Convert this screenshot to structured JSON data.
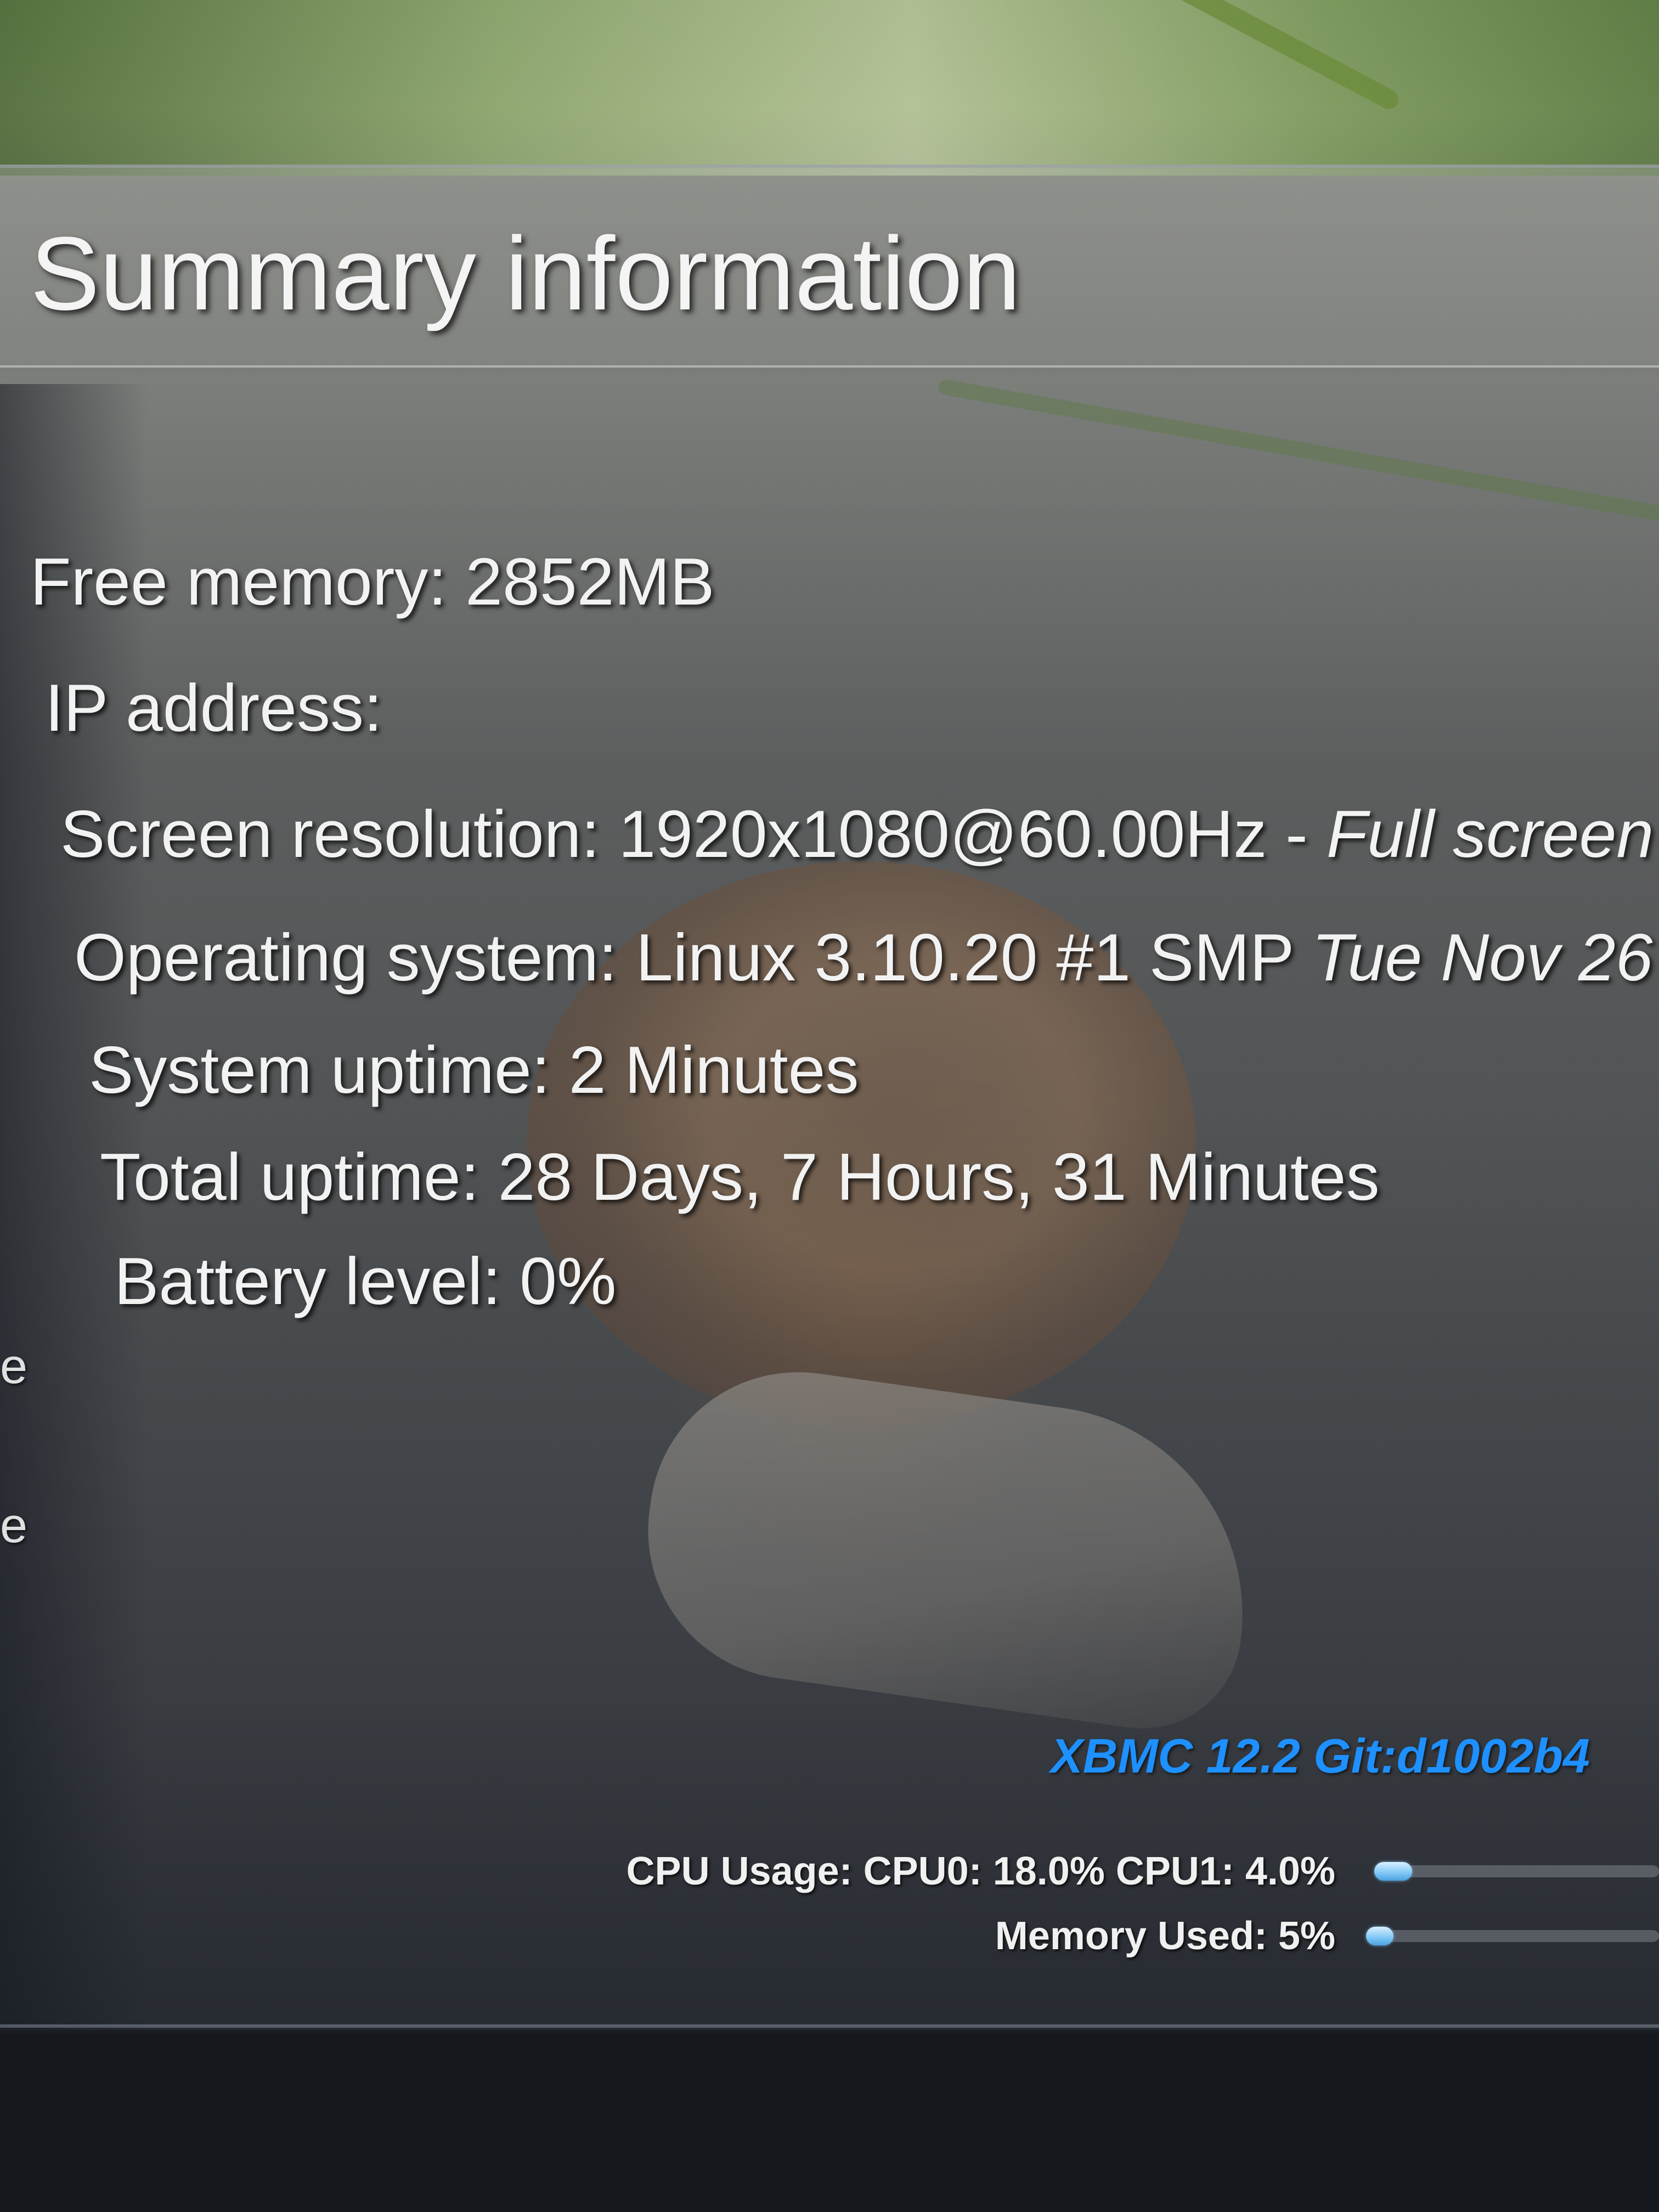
{
  "header": {
    "title": "Summary information"
  },
  "info": {
    "free_memory": "Free memory: 2852MB",
    "ip_address": "IP address:",
    "screen_resolution_label": "Screen resolution: 1920x1080@60.00Hz - ",
    "screen_resolution_mode": "Full screen",
    "operating_system_label": "Operating system: Linux 3.10.20 #1 SMP ",
    "operating_system_date": "Tue Nov 26",
    "system_uptime": "System uptime: 2 Minutes",
    "total_uptime": "Total uptime: 28 Days, 7 Hours, 31 Minutes",
    "battery_level": "Battery level: 0%"
  },
  "side_edge": {
    "char_1": "e",
    "char_2": "e"
  },
  "footer": {
    "build": "XBMC 12.2 Git:d1002b4",
    "cpu_usage_label": "CPU Usage: CPU0: 18.0% CPU1: 4.0%",
    "cpu_usage_fraction": 0.18,
    "memory_used_label": "Memory Used: 5%",
    "memory_used_fraction": 0.05
  },
  "colors": {
    "build_label": "#1e90ff",
    "meter_fill": "#7ec6f5",
    "text": "#f2f2f2"
  }
}
